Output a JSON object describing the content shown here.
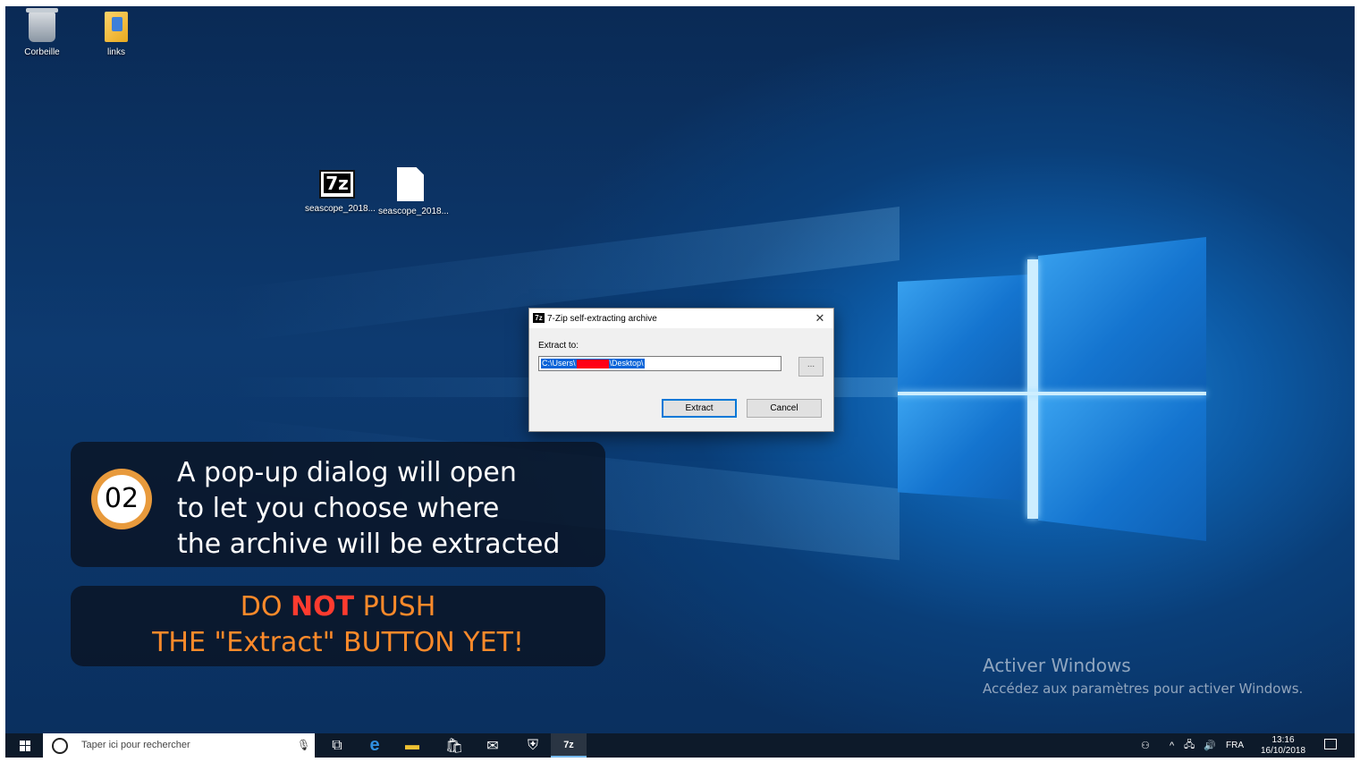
{
  "desktop": {
    "icons": [
      {
        "label": "Corbeille",
        "icon": "recycle-bin-icon"
      },
      {
        "label": "links",
        "icon": "folder-icon"
      },
      {
        "label": "seascope_2018...",
        "icon": "7zip-archive-icon",
        "glyph": "7z"
      },
      {
        "label": "seascope_2018...",
        "icon": "document-icon"
      }
    ]
  },
  "dialog": {
    "title": "7-Zip self-extracting archive",
    "title_glyph": "7z",
    "close_glyph": "✕",
    "extract_to_label": "Extract to:",
    "path_part1": "C:\\Users\\",
    "path_part2": "\\Desktop\\",
    "browse_label": "...",
    "extract_button": "Extract",
    "cancel_button": "Cancel"
  },
  "callout": {
    "step_number": "02",
    "line1": "A pop-up dialog will open",
    "line2": "to let you choose where",
    "line3": "the archive will be extracted",
    "warning_do": "DO ",
    "warning_not": "NOT",
    "warning_push": " PUSH",
    "warning_line2": "THE \"Extract\" BUTTON YET!"
  },
  "watermark": {
    "title": "Activer Windows",
    "subtitle": "Accédez aux paramètres pour activer Windows."
  },
  "taskbar": {
    "search_placeholder": "Taper ici pour rechercher",
    "apps": [
      {
        "icon": "task-view-icon",
        "glyph": "⧉"
      },
      {
        "icon": "edge-icon",
        "glyph": "e"
      },
      {
        "icon": "file-explorer-icon",
        "glyph": "▬"
      },
      {
        "icon": "store-icon",
        "glyph": "🛍"
      },
      {
        "icon": "mail-icon",
        "glyph": "✉"
      },
      {
        "icon": "defender-icon",
        "glyph": "⛨"
      },
      {
        "icon": "7zip-taskbar-icon",
        "glyph": "7z"
      }
    ],
    "tray": {
      "people_glyph": "⚇",
      "chevron_glyph": "^",
      "network_glyph": "🖧",
      "volume_glyph": "🔊",
      "language": "FRA",
      "time": "13:16",
      "date": "16/10/2018"
    },
    "colors": {
      "taskbar": "#0d1a2a",
      "accent": "#0078d7"
    }
  }
}
